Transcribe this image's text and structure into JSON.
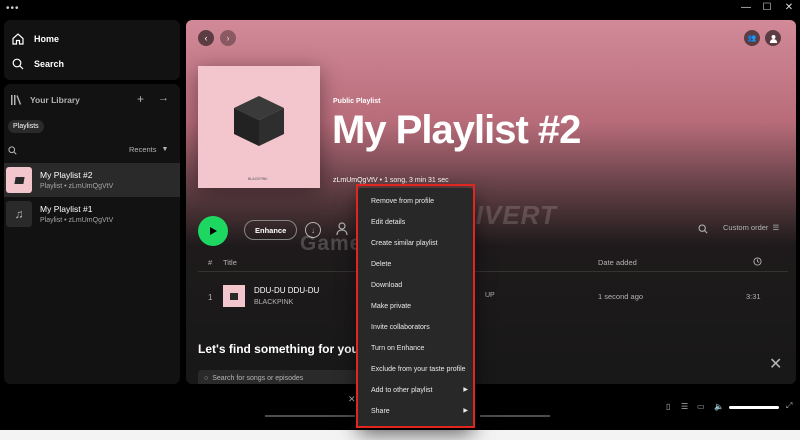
{
  "window": {
    "dots": "•••",
    "minimize": "—",
    "maximize": "☐",
    "close": "✕"
  },
  "nav": {
    "home": "Home",
    "search": "Search"
  },
  "library": {
    "title": "Your Library",
    "chip": "Playlists",
    "sort": "Recents",
    "playlists": [
      {
        "title": "My Playlist #2",
        "subtitle": "Playlist • zLmUmQgVtV"
      },
      {
        "title": "My Playlist #1",
        "subtitle": "Playlist • zLmUmQgVtV"
      }
    ]
  },
  "header": {
    "type": "Public Playlist",
    "title": "My Playlist #2",
    "owner": "zLmUmQgVtV • 1 song, 3 min 31 sec",
    "cover_label": "BLACKPINK",
    "cover_color": "#f2c6cc"
  },
  "actions": {
    "enhance": "Enhance",
    "custom_order": "Custom order"
  },
  "table": {
    "col_num": "#",
    "col_title": "Title",
    "col_album": "UP",
    "col_date": "Date added",
    "rows": [
      {
        "num": "1",
        "title": "DDU-DU DDU-DU",
        "artist": "BLACKPINK",
        "album": "UP",
        "date": "1 second ago",
        "duration": "3:31"
      }
    ]
  },
  "recommend": {
    "heading": "Let's find something for your pl",
    "search_placeholder": "Search for songs or episodes"
  },
  "context_menu": {
    "items": [
      {
        "label": "Remove from profile"
      },
      {
        "label": "Edit details"
      },
      {
        "label": "Create similar playlist"
      },
      {
        "label": "Delete"
      },
      {
        "label": "Download"
      },
      {
        "label": "Make private"
      },
      {
        "label": "Invite collaborators"
      },
      {
        "label": "Turn on Enhance"
      },
      {
        "label": "Exclude from your taste profile"
      },
      {
        "label": "Add to other playlist",
        "submenu": true
      },
      {
        "label": "Share",
        "submenu": true
      }
    ]
  },
  "watermark": {
    "top": "GAMEDIVERT",
    "bottom": "Gamedivert"
  },
  "colors": {
    "accent": "#1ed760",
    "highlight_box": "#e0261f"
  }
}
